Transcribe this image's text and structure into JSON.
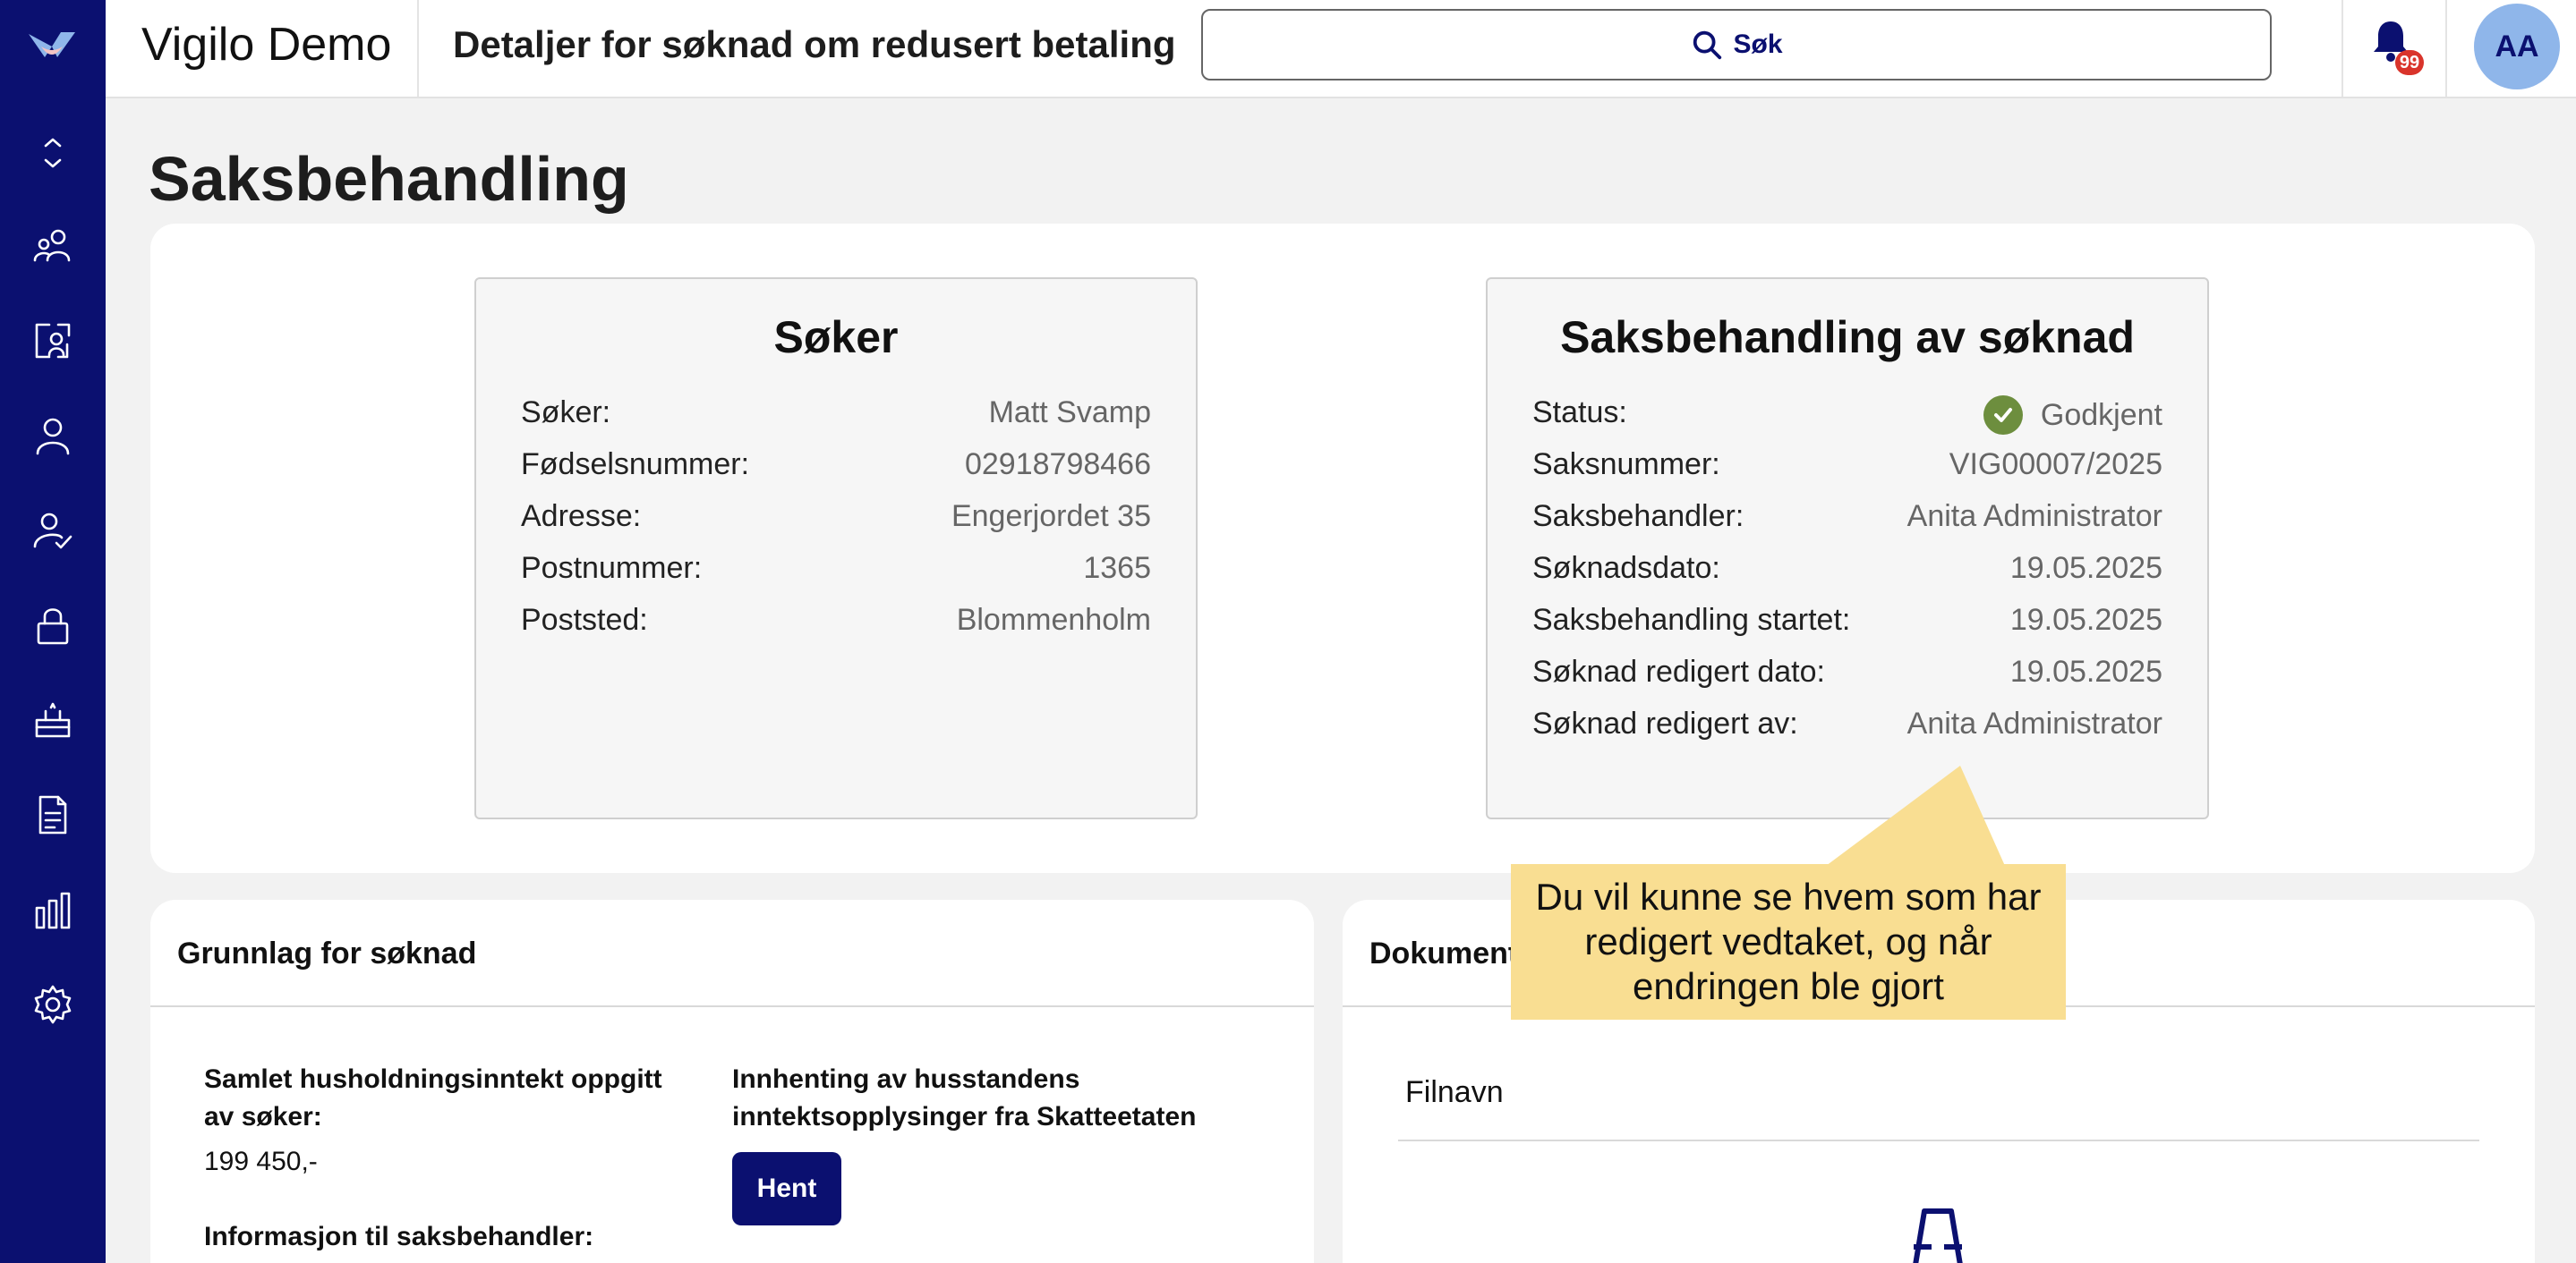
{
  "app": {
    "org_name": "Vigilo Demo",
    "page_heading": "Detaljer for søknad om redusert betaling"
  },
  "search": {
    "label": "Søk"
  },
  "notifications": {
    "count": "99"
  },
  "user": {
    "initials": "AA"
  },
  "sidebar": {
    "items": [
      {
        "icon": "expand-collapse-icon"
      },
      {
        "icon": "users-group-icon"
      },
      {
        "icon": "user-board-icon"
      },
      {
        "icon": "user-icon"
      },
      {
        "icon": "user-check-icon"
      },
      {
        "icon": "lock-icon"
      },
      {
        "icon": "tray-icon"
      },
      {
        "icon": "document-icon"
      },
      {
        "icon": "bar-chart-icon"
      },
      {
        "icon": "gear-icon"
      }
    ]
  },
  "main": {
    "title": "Saksbehandling"
  },
  "applicant": {
    "title": "Søker",
    "rows": [
      {
        "label": "Søker:",
        "value": "Matt Svamp"
      },
      {
        "label": "Fødselsnummer:",
        "value": "02918798466"
      },
      {
        "label": "Adresse:",
        "value": "Engerjordet 35"
      },
      {
        "label": "Postnummer:",
        "value": "1365"
      },
      {
        "label": "Poststed:",
        "value": "Blommenholm"
      }
    ]
  },
  "processing": {
    "title": "Saksbehandling av søknad",
    "status_label": "Status:",
    "status_value": "Godkjent",
    "status_color": "#6d8e3e",
    "rows": [
      {
        "label": "Saksnummer:",
        "value": "VIG00007/2025"
      },
      {
        "label": "Saksbehandler:",
        "value": "Anita Administrator"
      },
      {
        "label": "Søknadsdato:",
        "value": "19.05.2025"
      },
      {
        "label": "Saksbehandling startet:",
        "value": "19.05.2025"
      },
      {
        "label": "Søknad redigert dato:",
        "value": "19.05.2025"
      },
      {
        "label": "Søknad redigert av:",
        "value": "Anita Administrator"
      }
    ]
  },
  "basis": {
    "title": "Grunnlag for søknad",
    "income_label": "Samlet husholdningsinntekt oppgitt av søker:",
    "income_value": "199 450,-",
    "info_label": "Informasjon til saksbehandler:",
    "fetch_label": "Innhenting av husstandens inntektsopplysinger fra Skatteetaten",
    "fetch_button": "Hent"
  },
  "documents": {
    "title": "Dokument",
    "column_filename": "Filnavn"
  },
  "callout": {
    "text": "Du vil kunne se hvem som har redigert vedtaket, og når endringen ble gjort",
    "color": "#f9de92"
  },
  "colors": {
    "primary": "#0b1070",
    "avatar": "#8fb6ea",
    "badge": "#d9342b"
  }
}
